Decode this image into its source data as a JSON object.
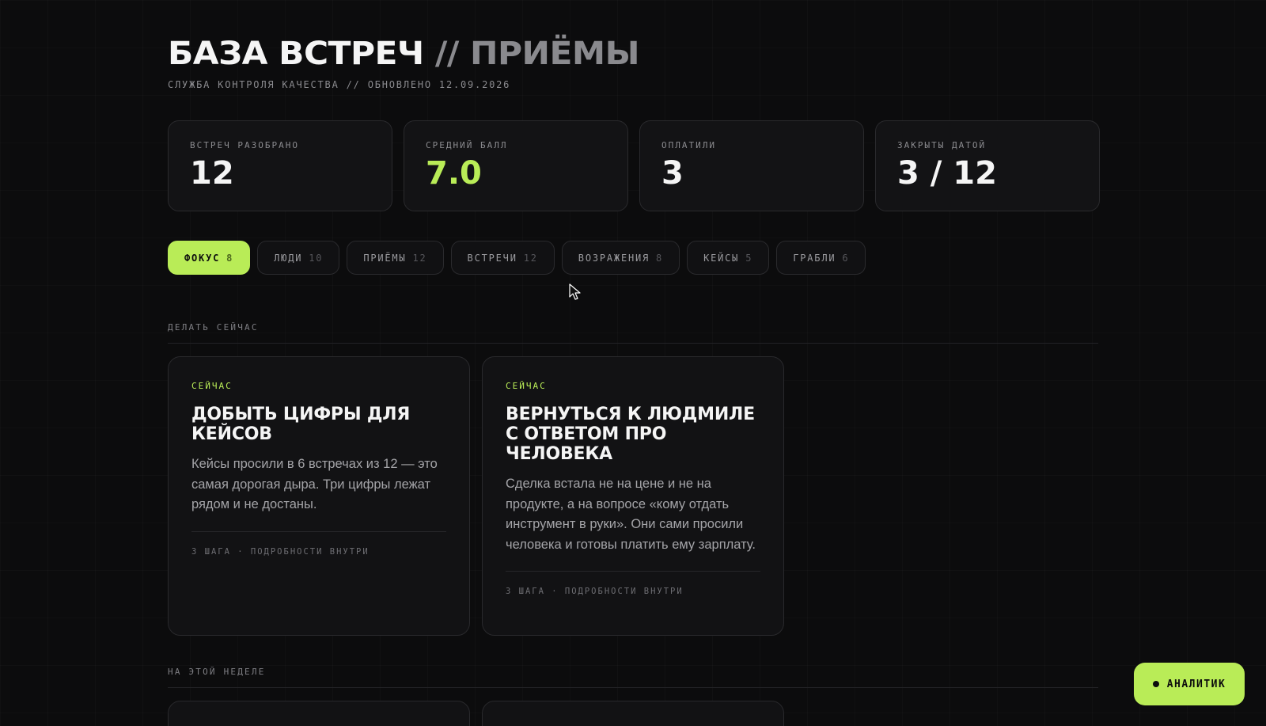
{
  "header": {
    "title_main": "БАЗА ВСТРЕЧ",
    "title_sep": " // ",
    "title_sub": "ПРИЁМЫ",
    "subtitle": "СЛУЖБА КОНТРОЛЯ КАЧЕСТВА // ОБНОВЛЕНО 12.09.2026"
  },
  "stats": [
    {
      "label": "ВСТРЕЧ РАЗОБРАНО",
      "value": "12"
    },
    {
      "label": "СРЕДНИЙ БАЛЛ",
      "value": "7.0"
    },
    {
      "label": "ОПЛАТИЛИ",
      "value": "3"
    },
    {
      "label": "ЗАКРЫТЫ ДАТОЙ",
      "value": "3 / 12"
    }
  ],
  "tabs": [
    {
      "label": "ФОКУС",
      "count": "8"
    },
    {
      "label": "ЛЮДИ",
      "count": "10"
    },
    {
      "label": "ПРИЁМЫ",
      "count": "12"
    },
    {
      "label": "ВСТРЕЧИ",
      "count": "12"
    },
    {
      "label": "ВОЗРАЖЕНИЯ",
      "count": "8"
    },
    {
      "label": "КЕЙСЫ",
      "count": "5"
    },
    {
      "label": "ГРАБЛИ",
      "count": "6"
    }
  ],
  "sections": {
    "now": "ДЕЛАТЬ СЕЙЧАС",
    "week": "НА ЭТОЙ НЕДЕЛЕ"
  },
  "cards": [
    {
      "tag": "СЕЙЧАС",
      "title": "Добыть цифры для кейсов",
      "text": "Кейсы просили в 6 встречах из 12 — это самая дорогая дыра. Три цифры лежат рядом и не достаны.",
      "meta": "3 ШАГА · ПОДРОБНОСТИ ВНУТРИ"
    },
    {
      "tag": "СЕЙЧАС",
      "title": "Вернуться к Людмиле с ответом про человека",
      "text": "Сделка встала не на цене и не на продукте, а на вопросе «кому отдать инструмент в руки». Они сами просили человека и готовы платить ему зарплату.",
      "meta": "3 ШАГА · ПОДРОБНОСТИ ВНУТРИ"
    }
  ],
  "analyst_button": "АНАЛИТИК",
  "colors": {
    "accent": "#b9ec57",
    "background": "#0c0c0d",
    "card": "#121214"
  }
}
